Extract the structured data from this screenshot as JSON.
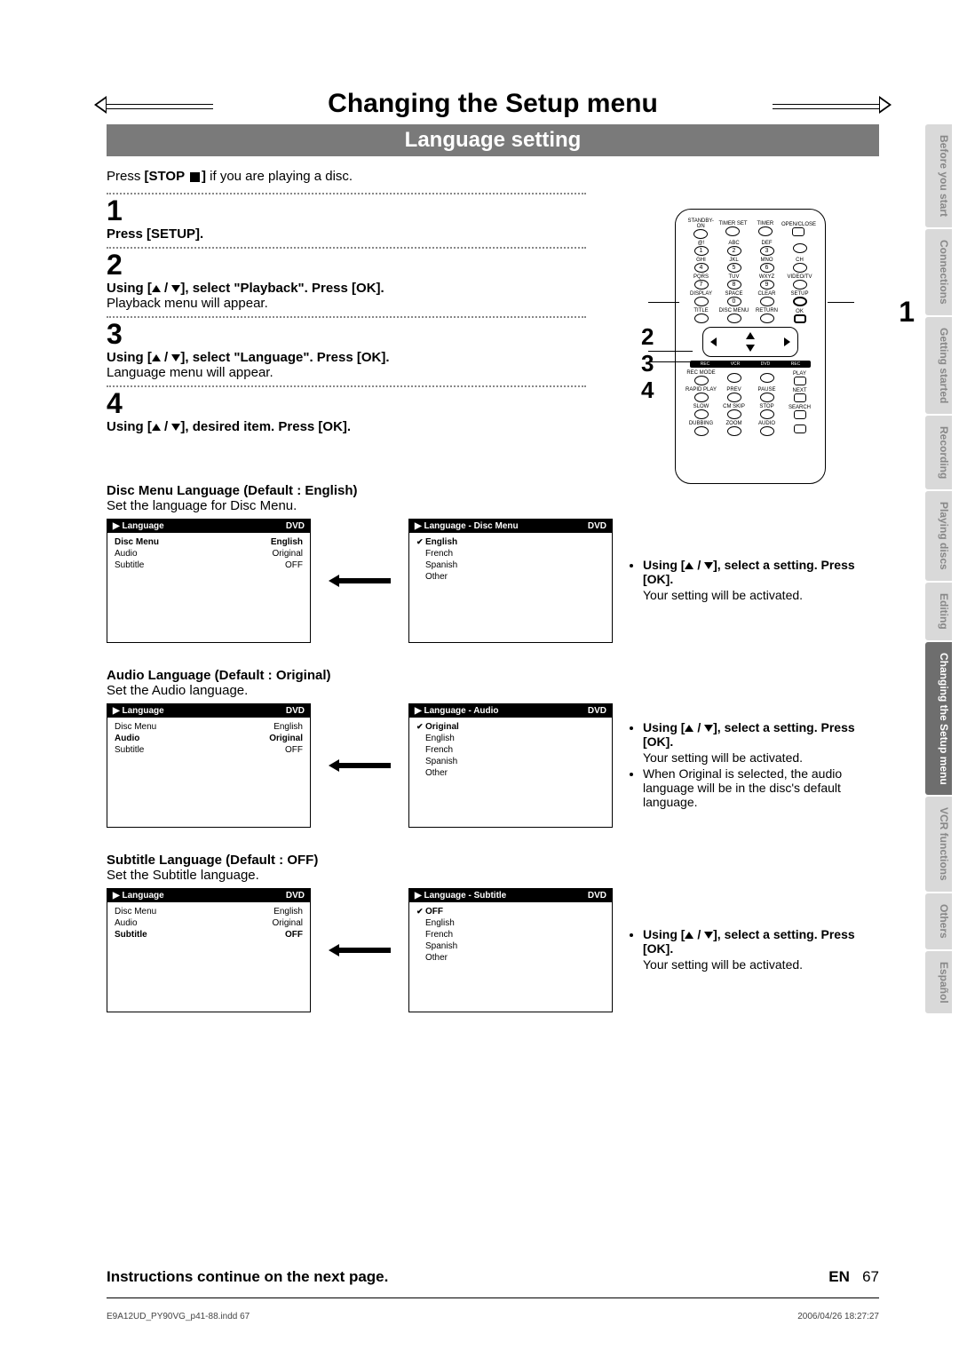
{
  "title": "Changing the Setup menu",
  "subtitle": "Language setting",
  "intro_prefix": "Press ",
  "intro_stop": "[STOP ",
  "intro_stop2": "]",
  "intro_suffix": " if you are playing a disc.",
  "steps": {
    "s1": {
      "num": "1",
      "bold": "Press [SETUP]."
    },
    "s2": {
      "num": "2",
      "bold_pre": "Using [",
      "bold_mid": " / ",
      "bold_post": "], select \"Playback\". Press [OK].",
      "plain": "Playback menu will appear."
    },
    "s3": {
      "num": "3",
      "bold_pre": "Using [",
      "bold_mid": " / ",
      "bold_post": "], select \"Language\". Press [OK].",
      "plain": "Language menu will appear."
    },
    "s4": {
      "num": "4",
      "bold_pre": "Using [",
      "bold_mid": " / ",
      "bold_post": "], desired item. Press [OK]."
    }
  },
  "callouts": {
    "one": "1",
    "stack": "2\n3\n4"
  },
  "remote_labels": {
    "row1": [
      "STANDBY-ON",
      "TIMER SET",
      "TIMER",
      "OPEN/CLOSE"
    ],
    "row2": [
      "@!",
      "ABC",
      "DEF",
      ""
    ],
    "num1": [
      "1",
      "2",
      "3",
      ""
    ],
    "row3": [
      "GHI",
      "JKL",
      "MNO",
      "CH"
    ],
    "num2": [
      "4",
      "5",
      "6",
      ""
    ],
    "row4": [
      "PQRS",
      "TUV",
      "WXYZ",
      "VIDEO/TV"
    ],
    "num3": [
      "7",
      "8",
      "9",
      ""
    ],
    "row5": [
      "DISPLAY",
      "SPACE",
      "CLEAR",
      "SETUP"
    ],
    "num4": [
      "",
      "0",
      "",
      ""
    ],
    "row6": [
      "TITLE",
      "DISC MENU",
      "RETURN",
      "OK"
    ],
    "bar": [
      "REC",
      "VCR",
      "DVD",
      "REC"
    ],
    "row7": [
      "REC MODE",
      "",
      "",
      "PLAY"
    ],
    "row8": [
      "RAPID PLAY",
      "PREV",
      "PAUSE",
      "NEXT"
    ],
    "row9": [
      "SLOW",
      "CM SKIP",
      "STOP",
      "SEARCH"
    ],
    "row10": [
      "DUBBING",
      "ZOOM",
      "AUDIO",
      ""
    ]
  },
  "sections": {
    "disc": {
      "head": "Disc Menu Language (Default : English)",
      "sub": "Set the language for Disc Menu.",
      "osd1_title": "Language",
      "osd1_badge": "DVD",
      "osd1_rows": [
        {
          "k": "Disc Menu",
          "v": "English",
          "sel": true
        },
        {
          "k": "Audio",
          "v": "Original"
        },
        {
          "k": "Subtitle",
          "v": "OFF"
        }
      ],
      "osd2_title": "Language - Disc Menu",
      "osd2_badge": "DVD",
      "osd2_items": [
        {
          "label": "English",
          "sel": true,
          "check": true
        },
        {
          "label": "French"
        },
        {
          "label": "Spanish"
        },
        {
          "label": "Other"
        }
      ],
      "note1_pre": "Using [",
      "note1_mid": " / ",
      "note1_post": "], select a setting. Press [OK].",
      "note2": "Your setting will be activated."
    },
    "audio": {
      "head": "Audio Language (Default : Original)",
      "sub": "Set the Audio language.",
      "osd1_title": "Language",
      "osd1_badge": "DVD",
      "osd1_rows": [
        {
          "k": "Disc Menu",
          "v": "English"
        },
        {
          "k": "Audio",
          "v": "Original",
          "sel": true
        },
        {
          "k": "Subtitle",
          "v": "OFF"
        }
      ],
      "osd2_title": "Language - Audio",
      "osd2_badge": "DVD",
      "osd2_items": [
        {
          "label": "Original",
          "sel": true,
          "check": true
        },
        {
          "label": "English"
        },
        {
          "label": "French"
        },
        {
          "label": "Spanish"
        },
        {
          "label": "Other"
        }
      ],
      "note1_pre": "Using [",
      "note1_mid": " / ",
      "note1_post": "], select a setting. Press [OK].",
      "note2": "Your setting will be activated.",
      "note3": "When Original is selected, the audio language will be in the disc's default language."
    },
    "subtitle": {
      "head": "Subtitle Language (Default : OFF)",
      "sub": "Set the Subtitle language.",
      "osd1_title": "Language",
      "osd1_badge": "DVD",
      "osd1_rows": [
        {
          "k": "Disc Menu",
          "v": "English"
        },
        {
          "k": "Audio",
          "v": "Original"
        },
        {
          "k": "Subtitle",
          "v": "OFF",
          "sel": true
        }
      ],
      "osd2_title": "Language - Subtitle",
      "osd2_badge": "DVD",
      "osd2_items": [
        {
          "label": "OFF",
          "sel": true,
          "check": true
        },
        {
          "label": "English"
        },
        {
          "label": "French"
        },
        {
          "label": "Spanish"
        },
        {
          "label": "Other"
        }
      ],
      "note1_pre": "Using [",
      "note1_mid": " / ",
      "note1_post": "], select a setting. Press [OK].",
      "note2": "Your setting will be activated."
    }
  },
  "tabs": [
    "Before you start",
    "Connections",
    "Getting started",
    "Recording",
    "Playing discs",
    "Editing",
    "Changing the Setup menu",
    "VCR functions",
    "Others",
    "Español"
  ],
  "tabs_active_index": 6,
  "footer": {
    "continue": "Instructions continue on the next page.",
    "lang": "EN",
    "page": "67"
  },
  "print": {
    "file": "E9A12UD_PY90VG_p41-88.indd   67",
    "stamp": "2006/04/26   18:27:27"
  }
}
